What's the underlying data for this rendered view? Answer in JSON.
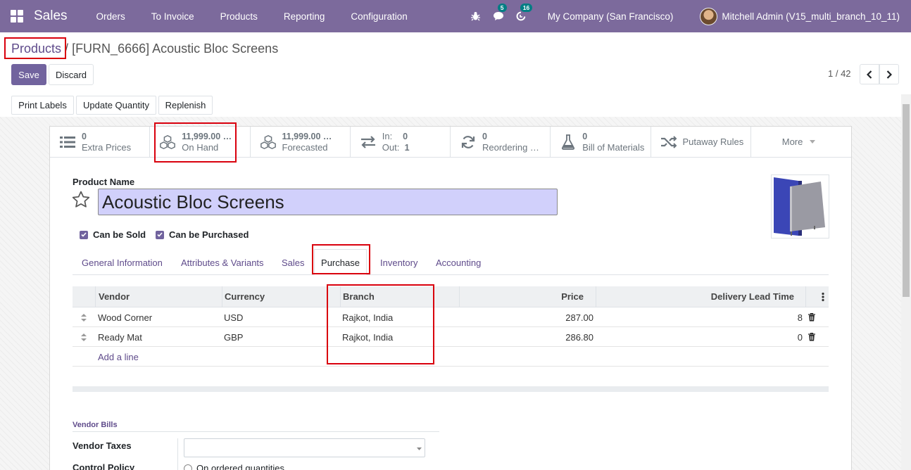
{
  "navbar": {
    "app_name": "Sales",
    "menu": [
      "Orders",
      "To Invoice",
      "Products",
      "Reporting",
      "Configuration"
    ],
    "messages_count": "5",
    "activities_count": "16",
    "company": "My Company (San Francisco)",
    "user": "Mitchell Admin (V15_multi_branch_10_11)"
  },
  "breadcrumb": {
    "parent": "Products",
    "separator": " / ",
    "current": "[FURN_6666] Acoustic Bloc Screens"
  },
  "actions": {
    "save": "Save",
    "discard": "Discard"
  },
  "pager": {
    "text": "1 / 42"
  },
  "status_buttons": [
    "Print Labels",
    "Update Quantity",
    "Replenish"
  ],
  "smart_buttons": [
    {
      "value": "0",
      "label": "Extra Prices",
      "icon": "list-icon"
    },
    {
      "value": "11,999.00 …",
      "label": "On Hand",
      "icon": "cubes-icon"
    },
    {
      "value": "11,999.00 …",
      "label": "Forecasted",
      "icon": "cubes-icon"
    },
    {
      "in_label": "In:",
      "in_value": "0",
      "out_label": "Out:",
      "out_value": "1",
      "icon": "exchange-icon"
    },
    {
      "value": "0",
      "label": "Reordering …",
      "icon": "refresh-icon"
    },
    {
      "value": "0",
      "label": "Bill of Materials",
      "icon": "flask-icon"
    },
    {
      "label": "Putaway Rules",
      "icon": "random-icon"
    },
    {
      "label": "More"
    }
  ],
  "product": {
    "name_label": "Product Name",
    "name": "Acoustic Bloc Screens",
    "can_be_sold": "Can be Sold",
    "can_be_purchased": "Can be Purchased"
  },
  "tabs": [
    "General Information",
    "Attributes & Variants",
    "Sales",
    "Purchase",
    "Inventory",
    "Accounting"
  ],
  "active_tab": "Purchase",
  "vendor_table": {
    "columns": [
      "Vendor",
      "Currency",
      "Branch",
      "Price",
      "Delivery Lead Time"
    ],
    "rows": [
      {
        "vendor": "Wood Corner",
        "currency": "USD",
        "branch": "Rajkot, India",
        "price": "287.00",
        "lead_time": "8"
      },
      {
        "vendor": "Ready Mat",
        "currency": "GBP",
        "branch": "Rajkot, India",
        "price": "286.80",
        "lead_time": "0"
      }
    ],
    "add_line": "Add a line"
  },
  "vendor_bills": {
    "section_title": "Vendor Bills",
    "taxes_label": "Vendor Taxes",
    "control_policy_label": "Control Policy",
    "control_option": "On ordered quantities"
  },
  "colors": {
    "navbar": "#7c6a9c",
    "primary": "#71639e",
    "highlight": "#d9000d",
    "badge": "#017e84"
  }
}
